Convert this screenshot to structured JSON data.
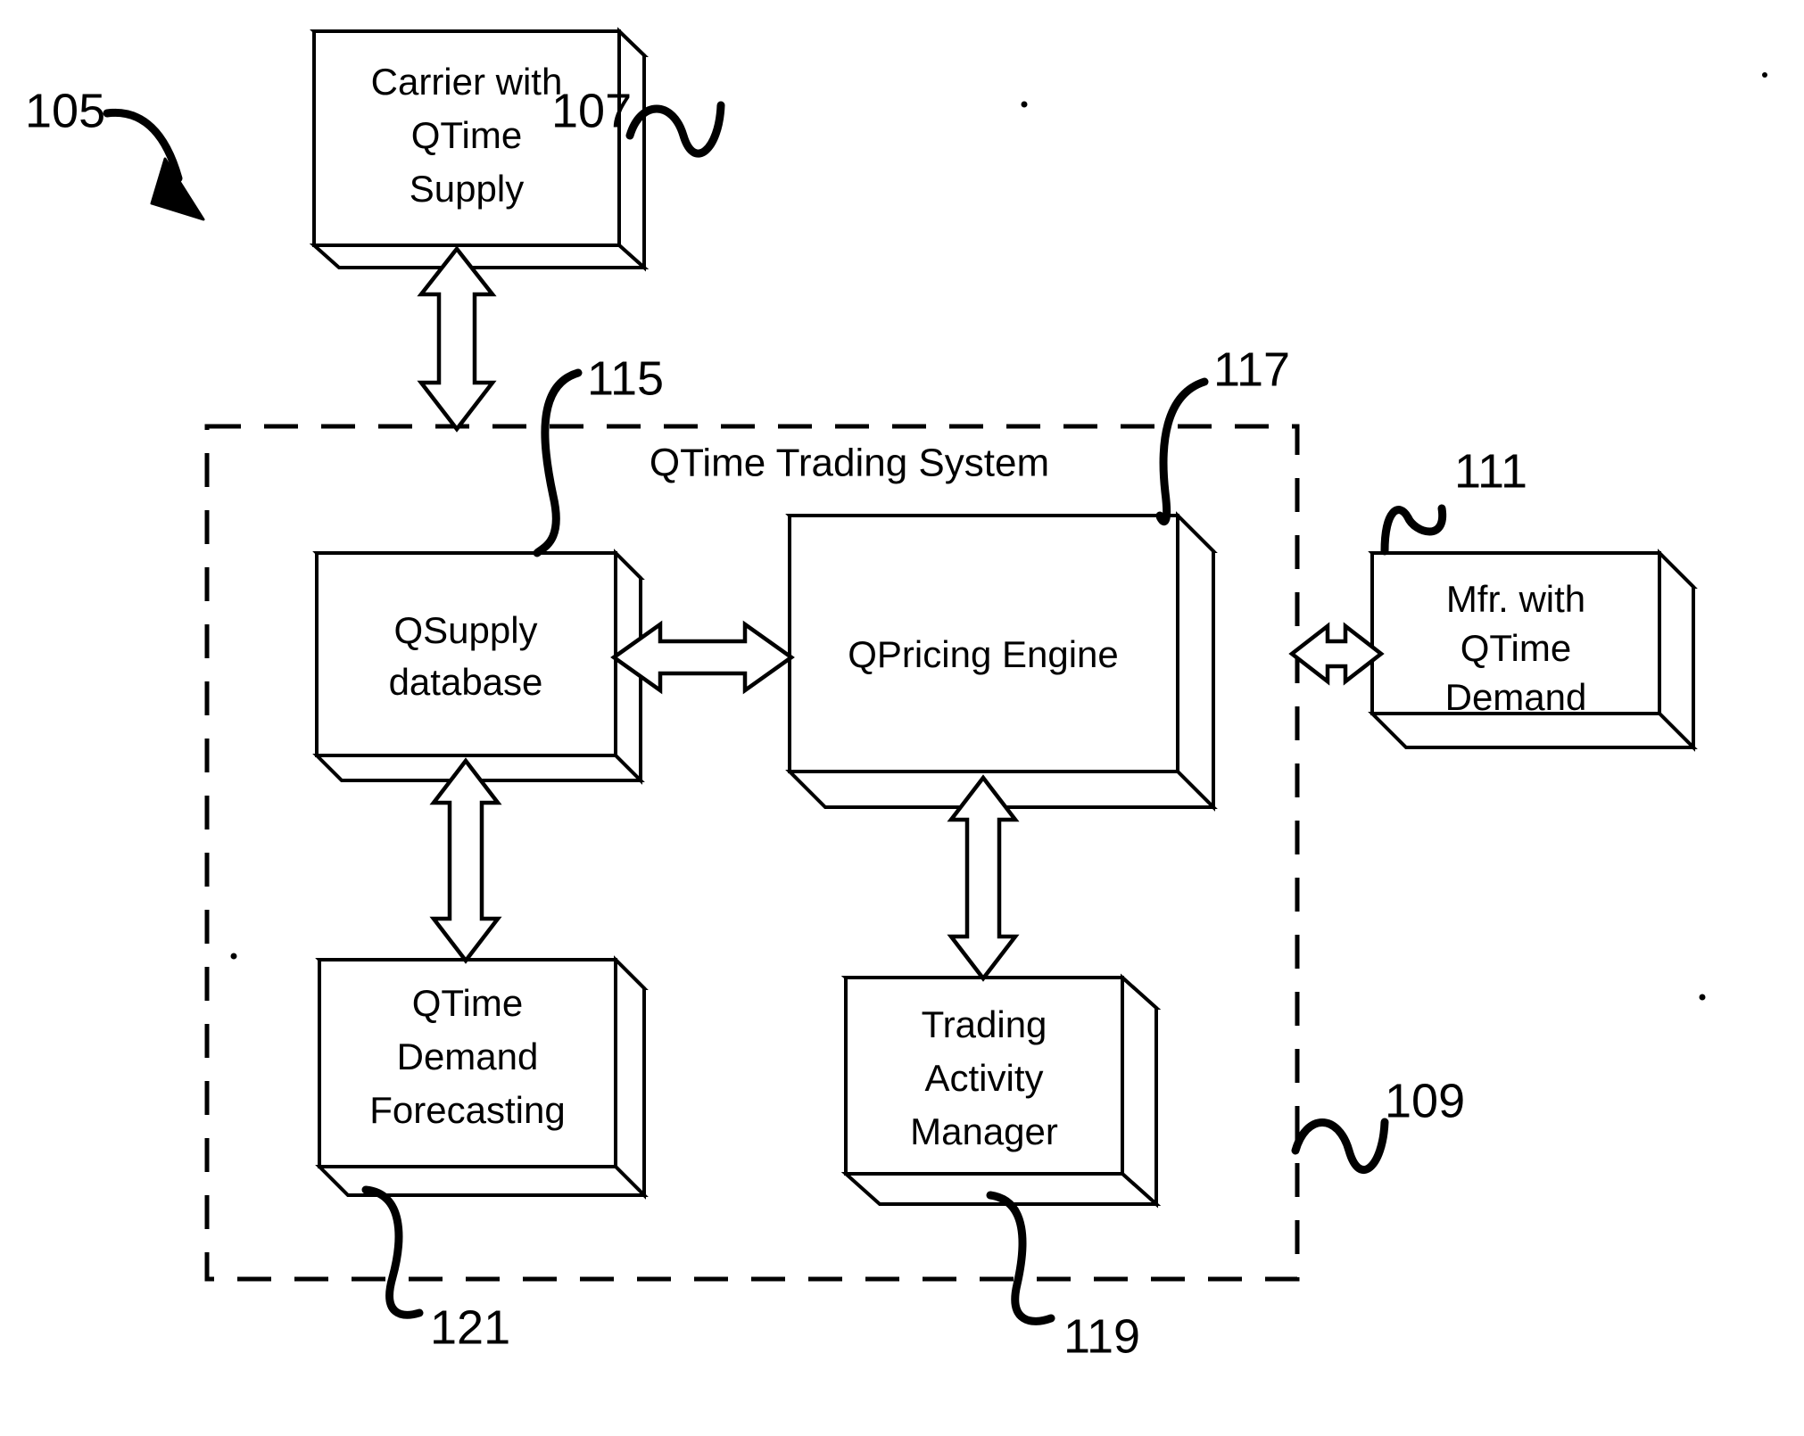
{
  "figure": {
    "title": "QTime Trading System block diagram",
    "system_ref": "105",
    "ink_color": "#000000",
    "background_color": "#ffffff"
  },
  "container": {
    "name": "qtime-trading-system",
    "title": "QTime Trading System",
    "ref": "109",
    "border_style": "dashed"
  },
  "nodes": {
    "carrier": {
      "id": "carrier-with-qtime-supply",
      "lines": [
        "Carrier with",
        "QTime",
        "Supply"
      ],
      "ref": "107"
    },
    "qsupply": {
      "id": "qsupply-database",
      "lines": [
        "QSupply",
        "database"
      ],
      "ref": "115"
    },
    "qpricing": {
      "id": "qpricing-engine",
      "lines": [
        "QPricing Engine"
      ],
      "ref": "117"
    },
    "mfr": {
      "id": "mfr-with-qtime-demand",
      "lines": [
        "Mfr. with",
        "QTime",
        "Demand"
      ],
      "ref": "111"
    },
    "forecasting": {
      "id": "qtime-demand-forecasting",
      "lines": [
        "QTime",
        "Demand",
        "Forecasting"
      ],
      "ref": "121"
    },
    "trading": {
      "id": "trading-activity-manager",
      "lines": [
        "Trading",
        "Activity",
        "Manager"
      ],
      "ref": "119"
    }
  },
  "connectors": [
    {
      "id": "carrier-to-system",
      "from": "carrier-with-qtime-supply",
      "to": "qtime-trading-system",
      "direction": "bidirectional",
      "orientation": "vertical"
    },
    {
      "id": "qsupply-to-qpricing",
      "from": "qsupply-database",
      "to": "qpricing-engine",
      "direction": "bidirectional",
      "orientation": "horizontal"
    },
    {
      "id": "qpricing-to-mfr",
      "from": "qpricing-engine",
      "to": "mfr-with-qtime-demand",
      "direction": "bidirectional",
      "orientation": "horizontal"
    },
    {
      "id": "forecasting-to-qsupply",
      "from": "qtime-demand-forecasting",
      "to": "qsupply-database",
      "direction": "bidirectional",
      "orientation": "vertical"
    },
    {
      "id": "trading-to-qpricing",
      "from": "trading-activity-manager",
      "to": "qpricing-engine",
      "direction": "bidirectional",
      "orientation": "vertical"
    }
  ],
  "reference_numerals": [
    {
      "id": "ref-105",
      "value": "105",
      "points_to": "whole-figure",
      "leader": "curved-arrow"
    },
    {
      "id": "ref-107",
      "value": "107",
      "points_to": "carrier-with-qtime-supply",
      "leader": "squiggle"
    },
    {
      "id": "ref-109",
      "value": "109",
      "points_to": "qtime-trading-system",
      "leader": "squiggle"
    },
    {
      "id": "ref-111",
      "value": "111",
      "points_to": "mfr-with-qtime-demand",
      "leader": "squiggle"
    },
    {
      "id": "ref-115",
      "value": "115",
      "points_to": "qsupply-database",
      "leader": "curve"
    },
    {
      "id": "ref-117",
      "value": "117",
      "points_to": "qpricing-engine",
      "leader": "curve"
    },
    {
      "id": "ref-119",
      "value": "119",
      "points_to": "trading-activity-manager",
      "leader": "curve"
    },
    {
      "id": "ref-121",
      "value": "121",
      "points_to": "qtime-demand-forecasting",
      "leader": "curve"
    }
  ]
}
